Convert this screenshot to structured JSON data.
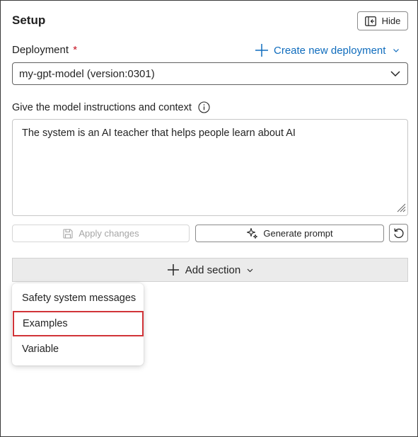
{
  "panel": {
    "title": "Setup",
    "hide_label": "Hide"
  },
  "deployment": {
    "label": "Deployment",
    "required_marker": "*",
    "create_link_label": "Create new deployment",
    "selected_value": "my-gpt-model (version:0301)"
  },
  "instructions": {
    "label": "Give the model instructions and context",
    "value": "The system is an AI teacher that helps people learn about AI"
  },
  "actions": {
    "apply_label": "Apply changes",
    "generate_label": "Generate prompt"
  },
  "add_section": {
    "label": "Add section",
    "menu_items": [
      {
        "label": "Safety system messages"
      },
      {
        "label": "Examples",
        "highlighted": true
      },
      {
        "label": "Variable"
      }
    ]
  },
  "colors": {
    "accent": "#0f6cbd",
    "required": "#c50f1f",
    "highlight_border": "#d13438",
    "section_bg": "#ebebeb"
  },
  "icons": {
    "hide": "panel-collapse-icon",
    "create": "plus-icon",
    "dropdown": "chevron-down-icon",
    "info": "info-icon",
    "apply": "save-icon",
    "generate": "sparkle-icon",
    "reset": "reset-icon",
    "add": "plus-icon"
  }
}
